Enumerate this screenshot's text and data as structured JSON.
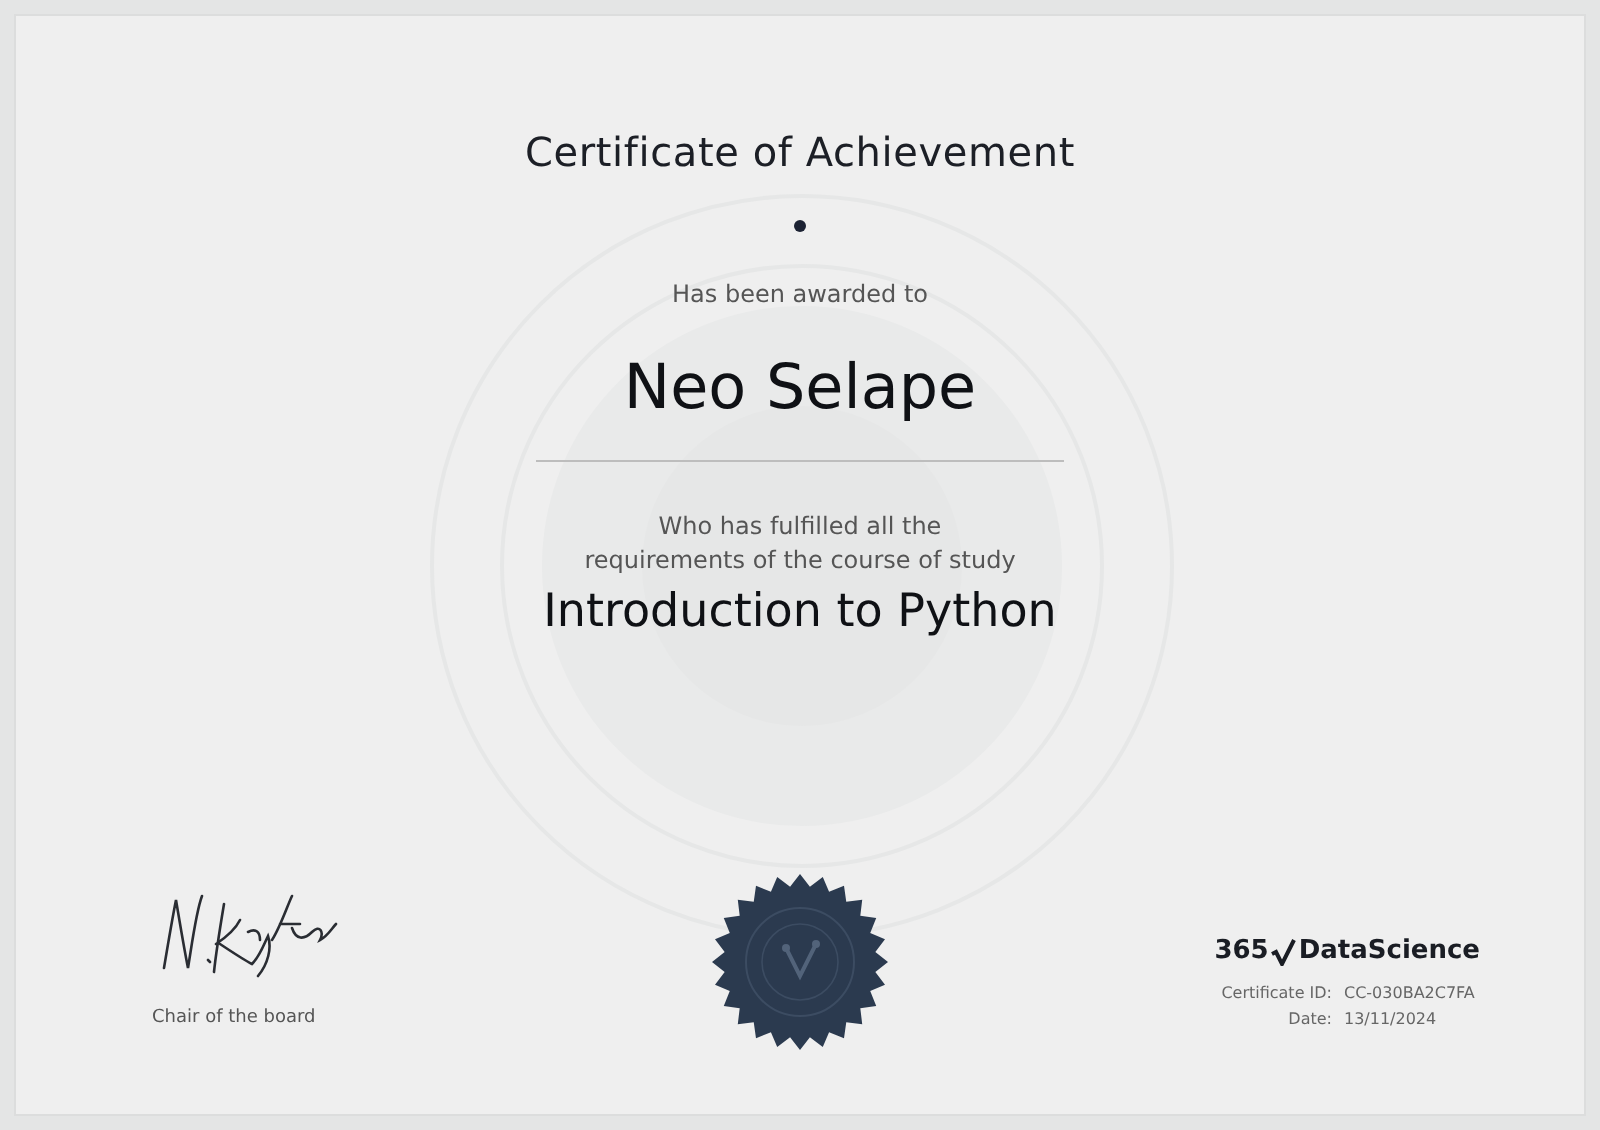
{
  "certificate": {
    "title": "Certificate of Achievement",
    "intro": "Has been awarded to",
    "recipient": "Neo Selape",
    "statement_lines": [
      "Who has fulfilled all the",
      "requirements of the course of study"
    ],
    "course": "Introduction to Python"
  },
  "signature": {
    "role": "Chair of the board"
  },
  "brand": {
    "number": "365",
    "name": "DataScience"
  },
  "details": [
    {
      "label": "Certificate ID:",
      "value": "CC-030BA2C7FA"
    },
    {
      "label": "Date:",
      "value": "13/11/2024"
    }
  ]
}
